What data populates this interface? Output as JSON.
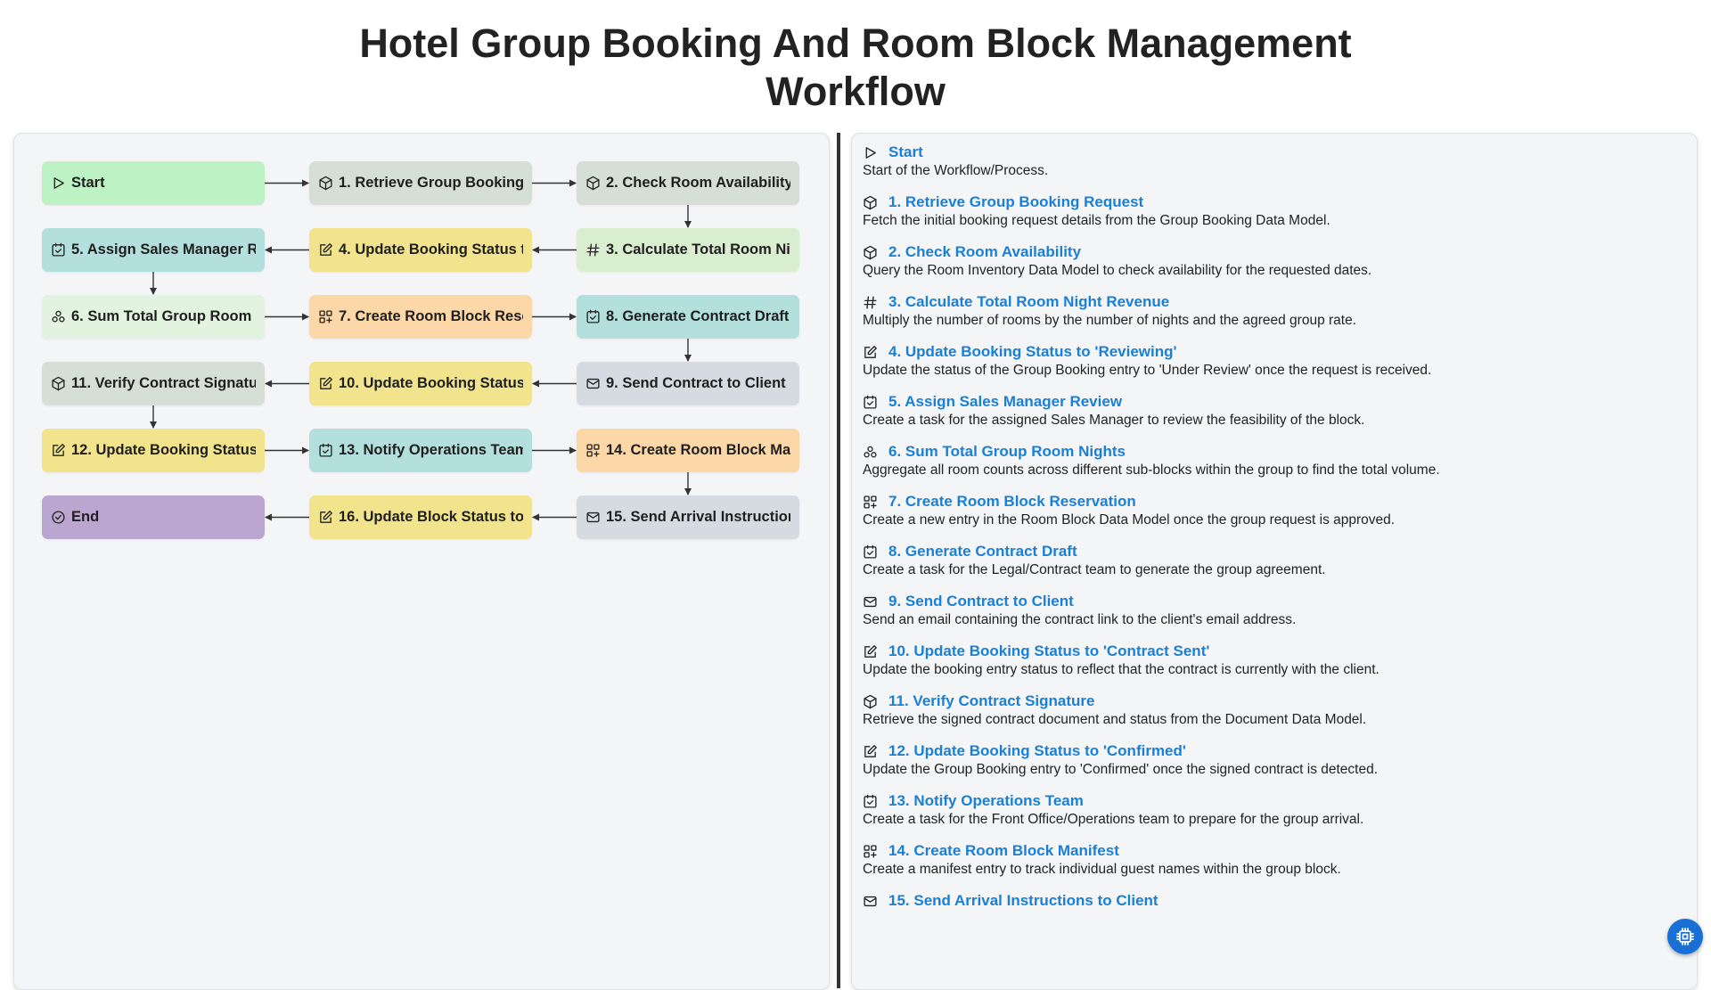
{
  "title": "Hotel Group Booking And Room Block Management Workflow",
  "colors": {
    "start": "#bdf2c4",
    "green_grey": "#d6dfd6",
    "light_green": "#d8eecf",
    "teal": "#b3e0dc",
    "yellow": "#f1e48d",
    "pale_green": "#e2f3df",
    "orange": "#fcd8a8",
    "slate": "#d6dbe1",
    "end": "#bba6d0",
    "link": "#1a7fd6"
  },
  "nodes": [
    {
      "id": "start",
      "label": "Start",
      "icon": "play-icon",
      "color": "start"
    },
    {
      "id": "n1",
      "label": "1. Retrieve Group Booking Request",
      "icon": "cube-icon",
      "color": "green_grey"
    },
    {
      "id": "n2",
      "label": "2. Check Room Availability",
      "icon": "cube-icon",
      "color": "green_grey"
    },
    {
      "id": "n3",
      "label": "3. Calculate Total Room Night Revenue",
      "icon": "hash-icon",
      "color": "light_green"
    },
    {
      "id": "n4",
      "label": "4. Update Booking Status to 'Reviewing'",
      "icon": "edit-icon",
      "color": "yellow"
    },
    {
      "id": "n5",
      "label": "5. Assign Sales Manager Review",
      "icon": "checkbox-icon",
      "color": "teal"
    },
    {
      "id": "n6",
      "label": "6. Sum Total Group Room Nights",
      "icon": "aggregate-icon",
      "color": "pale_green"
    },
    {
      "id": "n7",
      "label": "7. Create Room Block Reservation",
      "icon": "grid-plus-icon",
      "color": "orange"
    },
    {
      "id": "n8",
      "label": "8. Generate Contract Draft",
      "icon": "checkbox-icon",
      "color": "teal"
    },
    {
      "id": "n9",
      "label": "9. Send Contract to Client",
      "icon": "mail-icon",
      "color": "slate"
    },
    {
      "id": "n10",
      "label": "10. Update Booking Status to 'Contract Sent'",
      "icon": "edit-icon",
      "color": "yellow"
    },
    {
      "id": "n11",
      "label": "11. Verify Contract Signature",
      "icon": "cube-icon",
      "color": "green_grey"
    },
    {
      "id": "n12",
      "label": "12. Update Booking Status to 'Confirmed'",
      "icon": "edit-icon",
      "color": "yellow"
    },
    {
      "id": "n13",
      "label": "13. Notify Operations Team",
      "icon": "checkbox-icon",
      "color": "teal"
    },
    {
      "id": "n14",
      "label": "14. Create Room Block Manifest",
      "icon": "grid-plus-icon",
      "color": "orange"
    },
    {
      "id": "n15",
      "label": "15. Send Arrival Instructions to Client",
      "icon": "mail-icon",
      "color": "slate"
    },
    {
      "id": "n16",
      "label": "16. Update Block Status to",
      "icon": "edit-icon",
      "color": "yellow"
    },
    {
      "id": "end",
      "label": "End",
      "icon": "check-circle-icon",
      "color": "end"
    }
  ],
  "descriptions": [
    {
      "title": "Start",
      "text": "Start of the Workflow/Process.",
      "icon": "play-icon"
    },
    {
      "title": "1. Retrieve Group Booking Request",
      "text": "Fetch the initial booking request details from the Group Booking Data Model.",
      "icon": "cube-icon"
    },
    {
      "title": "2. Check Room Availability",
      "text": "Query the Room Inventory Data Model to check availability for the requested dates.",
      "icon": "cube-icon"
    },
    {
      "title": "3. Calculate Total Room Night Revenue",
      "text": "Multiply the number of rooms by the number of nights and the agreed group rate.",
      "icon": "hash-icon"
    },
    {
      "title": "4. Update Booking Status to 'Reviewing'",
      "text": "Update the status of the Group Booking entry to 'Under Review' once the request is received.",
      "icon": "edit-icon"
    },
    {
      "title": "5. Assign Sales Manager Review",
      "text": "Create a task for the assigned Sales Manager to review the feasibility of the block.",
      "icon": "checkbox-icon"
    },
    {
      "title": "6. Sum Total Group Room Nights",
      "text": "Aggregate all room counts across different sub-blocks within the group to find the total volume.",
      "icon": "aggregate-icon"
    },
    {
      "title": "7. Create Room Block Reservation",
      "text": "Create a new entry in the Room Block Data Model once the group request is approved.",
      "icon": "grid-plus-icon"
    },
    {
      "title": "8. Generate Contract Draft",
      "text": "Create a task for the Legal/Contract team to generate the group agreement.",
      "icon": "checkbox-icon"
    },
    {
      "title": "9. Send Contract to Client",
      "text": "Send an email containing the contract link to the client's email address.",
      "icon": "mail-icon"
    },
    {
      "title": "10. Update Booking Status to 'Contract Sent'",
      "text": "Update the booking entry status to reflect that the contract is currently with the client.",
      "icon": "edit-icon"
    },
    {
      "title": "11. Verify Contract Signature",
      "text": "Retrieve the signed contract document and status from the Document Data Model.",
      "icon": "cube-icon"
    },
    {
      "title": "12. Update Booking Status to 'Confirmed'",
      "text": "Update the Group Booking entry to 'Confirmed' once the signed contract is detected.",
      "icon": "edit-icon"
    },
    {
      "title": "13. Notify Operations Team",
      "text": "Create a task for the Front Office/Operations team to prepare for the group arrival.",
      "icon": "checkbox-icon"
    },
    {
      "title": "14. Create Room Block Manifest",
      "text": "Create a manifest entry to track individual guest names within the group block.",
      "icon": "grid-plus-icon"
    },
    {
      "title": "15. Send Arrival Instructions to Client",
      "text": "",
      "icon": "mail-icon"
    }
  ],
  "fab_icon": "cpu-icon"
}
